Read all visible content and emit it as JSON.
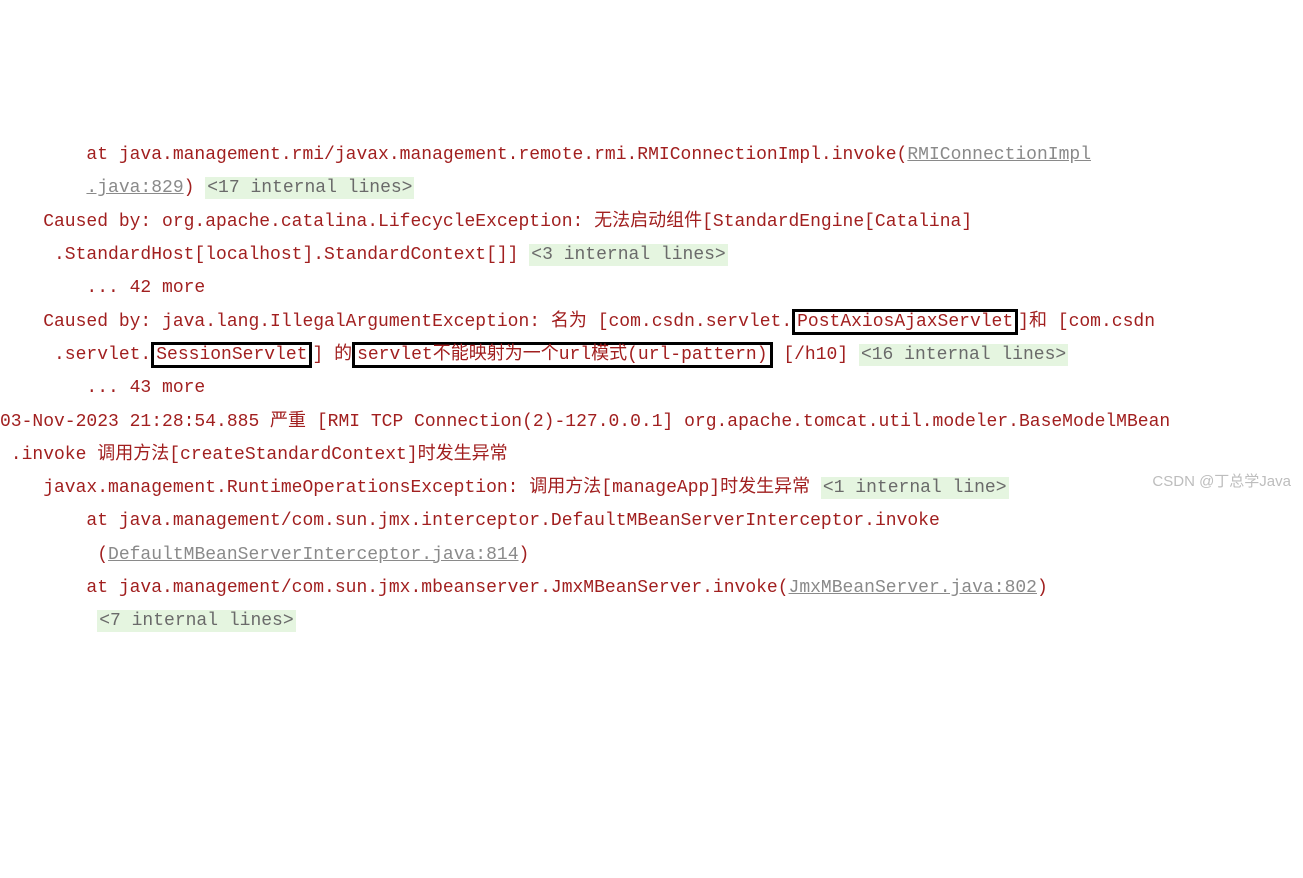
{
  "line1": {
    "prefix": "        at java.management.rmi/javax.management.remote.rmi.RMIConnectionImpl.invoke(",
    "link": "RMIConnectionImpl",
    "linkCont": ".java:829",
    "prefix2": "        ",
    "closeParen": ") ",
    "internal": "<17 internal lines>"
  },
  "line3": {
    "text": "    Caused by: org.apache.catalina.LifecycleException: 无法启动组件[StandardEngine[Catalina]"
  },
  "line4": {
    "prefix": "     .StandardHost[localhost].StandardContext[]] ",
    "internal": "<3 internal lines>"
  },
  "line5": {
    "text": "        ... 42 more"
  },
  "line6": {
    "prefix": "    Caused by: java.lang.IllegalArgumentException: 名为 [com.csdn.servlet.",
    "box1": "PostAxiosAjaxServlet",
    "mid": "]和 [com.csdn"
  },
  "line7": {
    "prefix": "     .servlet.",
    "box2": "SessionServlet",
    "mid1": "] 的",
    "box3": "servlet不能映射为一个url模式(url-pattern)",
    "mid2": " [/h10] ",
    "internal": "<16 internal lines>"
  },
  "line8": {
    "text": "        ... 43 more"
  },
  "line9": {
    "text": "03-Nov-2023 21:28:54.885 严重 [RMI TCP Connection(2)-127.0.0.1] org.apache.tomcat.util.modeler.BaseModelMBean"
  },
  "line10": {
    "text": " .invoke 调用方法[createStandardContext]时发生异常"
  },
  "line11": {
    "prefix": "    javax.management.RuntimeOperationsException: 调用方法[manageApp]时发生异常 ",
    "internal": "<1 internal line>"
  },
  "line12": {
    "text": "        at java.management/com.sun.jmx.interceptor.DefaultMBeanServerInterceptor.invoke"
  },
  "line13": {
    "prefix": "         (",
    "link": "DefaultMBeanServerInterceptor.java:814",
    "suffix": ")"
  },
  "line14": {
    "prefix": "        at java.management/com.sun.jmx.mbeanserver.JmxMBeanServer.invoke(",
    "link": "JmxMBeanServer.java:802",
    "suffix": ")"
  },
  "line15": {
    "prefix": "         ",
    "internal": "<7 internal lines>"
  },
  "watermark": "CSDN @丁总学Java"
}
